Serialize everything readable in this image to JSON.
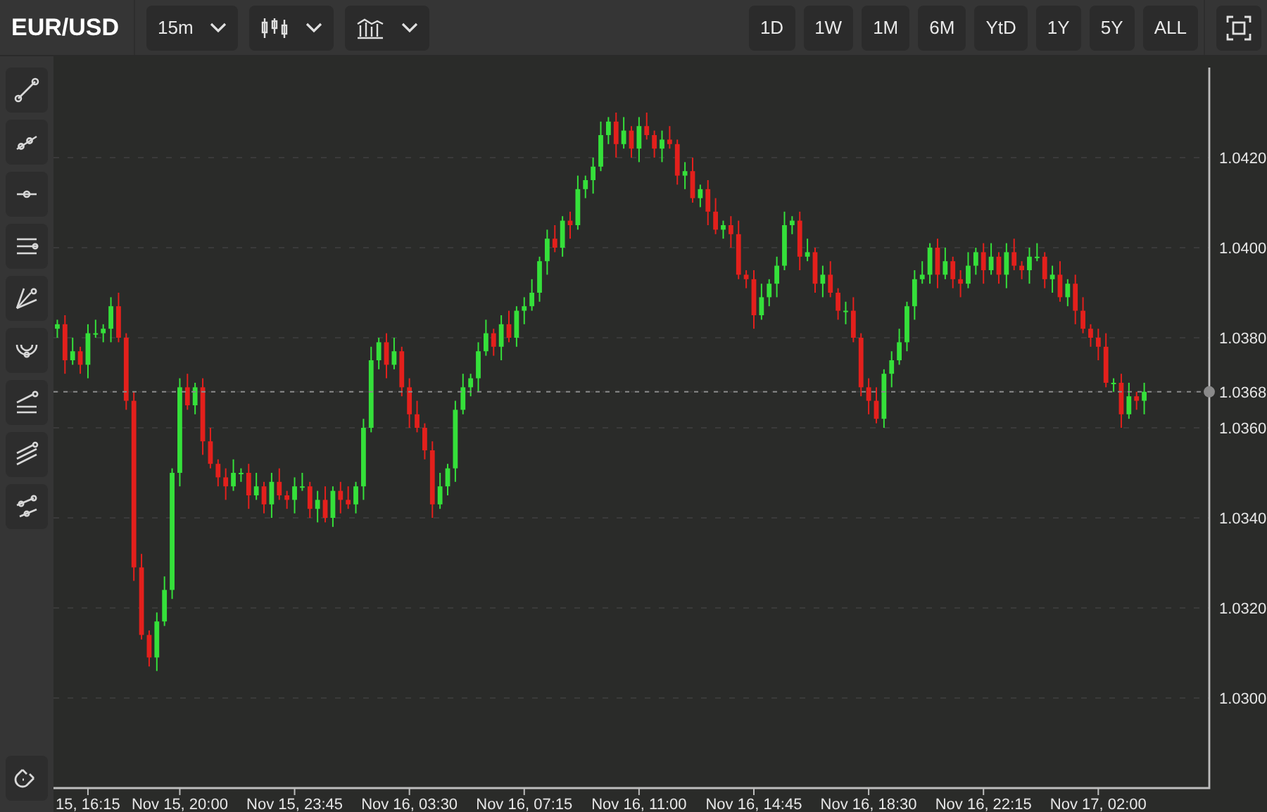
{
  "symbol": "EUR/USD",
  "interval": {
    "label": "15m"
  },
  "ranges": [
    {
      "label": "1D",
      "selected": false
    },
    {
      "label": "1W",
      "selected": false
    },
    {
      "label": "1M",
      "selected": false
    },
    {
      "label": "6M",
      "selected": false
    },
    {
      "label": "YtD",
      "selected": false
    },
    {
      "label": "1Y",
      "selected": false
    },
    {
      "label": "5Y",
      "selected": false
    },
    {
      "label": "ALL",
      "selected": false
    }
  ],
  "chart": {
    "chart_data": {
      "type": "candlestick",
      "categories": [
        null,
        null,
        null,
        null,
        "15, 16:15",
        null,
        null,
        null,
        null,
        null,
        null,
        null,
        null,
        null,
        null,
        null,
        "Nov 15, 20:00",
        null,
        null,
        null,
        null,
        null,
        null,
        null,
        null,
        null,
        null,
        null,
        null,
        null,
        null,
        "Nov 15, 23:45",
        null,
        null,
        null,
        null,
        null,
        null,
        null,
        null,
        null,
        null,
        null,
        null,
        null,
        null,
        "Nov 16, 03:30",
        null,
        null,
        null,
        null,
        null,
        null,
        null,
        null,
        null,
        null,
        null,
        null,
        null,
        null,
        "Nov 16, 07:15",
        null,
        null,
        null,
        null,
        null,
        null,
        null,
        null,
        null,
        null,
        null,
        null,
        null,
        null,
        "Nov 16, 11:00",
        null,
        null,
        null,
        null,
        null,
        null,
        null,
        null,
        null,
        null,
        null,
        null,
        null,
        null,
        "Nov 16, 14:45",
        null,
        null,
        null,
        null,
        null,
        null,
        null,
        null,
        null,
        null,
        null,
        null,
        null,
        null,
        "Nov 16, 18:30",
        null,
        null,
        null,
        null,
        null,
        null,
        null,
        null,
        null,
        null,
        null,
        null,
        null,
        null,
        "Nov 16, 22:15",
        null,
        null,
        null,
        null,
        null,
        null,
        null,
        null,
        null,
        null,
        null,
        null,
        null,
        null,
        "Nov 17, 02:00",
        null,
        null,
        null,
        null,
        null,
        null
      ],
      "ohlc": [
        [
          1.0382,
          1.0384,
          1.038,
          1.0383
        ],
        [
          1.0383,
          1.0385,
          1.0372,
          1.0375
        ],
        [
          1.0375,
          1.038,
          1.0374,
          1.0377
        ],
        [
          1.0377,
          1.0378,
          1.0372,
          1.0374
        ],
        [
          1.0374,
          1.0383,
          1.0371,
          1.0381
        ],
        [
          1.0381,
          1.0384,
          1.038,
          1.0381
        ],
        [
          1.0381,
          1.0383,
          1.0379,
          1.0382
        ],
        [
          1.0382,
          1.0389,
          1.0379,
          1.0387
        ],
        [
          1.0387,
          1.039,
          1.0379,
          1.038
        ],
        [
          1.038,
          1.0381,
          1.0364,
          1.0366
        ],
        [
          1.0366,
          1.0368,
          1.0326,
          1.0329
        ],
        [
          1.0329,
          1.0332,
          1.0313,
          1.0314
        ],
        [
          1.0314,
          1.0315,
          1.0307,
          1.0309
        ],
        [
          1.0309,
          1.0319,
          1.0306,
          1.0317
        ],
        [
          1.0317,
          1.0327,
          1.0316,
          1.0324
        ],
        [
          1.0324,
          1.0351,
          1.0322,
          1.035
        ],
        [
          1.035,
          1.0371,
          1.0347,
          1.0369
        ],
        [
          1.0369,
          1.0372,
          1.0364,
          1.0365
        ],
        [
          1.0365,
          1.037,
          1.0363,
          1.0369
        ],
        [
          1.0369,
          1.0371,
          1.0354,
          1.0357
        ],
        [
          1.0357,
          1.036,
          1.0351,
          1.0352
        ],
        [
          1.0352,
          1.0353,
          1.0347,
          1.0349
        ],
        [
          1.0349,
          1.0351,
          1.0344,
          1.0347
        ],
        [
          1.0347,
          1.0353,
          1.0346,
          1.035
        ],
        [
          1.035,
          1.0351,
          1.0348,
          1.035
        ],
        [
          1.035,
          1.0352,
          1.0342,
          1.0345
        ],
        [
          1.0345,
          1.035,
          1.0344,
          1.0347
        ],
        [
          1.0347,
          1.0348,
          1.0341,
          1.0343
        ],
        [
          1.0343,
          1.035,
          1.034,
          1.0348
        ],
        [
          1.0348,
          1.0351,
          1.0344,
          1.0345
        ],
        [
          1.0345,
          1.0346,
          1.0342,
          1.0344
        ],
        [
          1.0344,
          1.0349,
          1.0341,
          1.0347
        ],
        [
          1.0347,
          1.035,
          1.0346,
          1.0347
        ],
        [
          1.0347,
          1.0348,
          1.034,
          1.0342
        ],
        [
          1.0342,
          1.0346,
          1.0339,
          1.0344
        ],
        [
          1.0344,
          1.0347,
          1.0339,
          1.034
        ],
        [
          1.034,
          1.0347,
          1.0338,
          1.0346
        ],
        [
          1.0346,
          1.0348,
          1.0341,
          1.0344
        ],
        [
          1.0344,
          1.0347,
          1.0342,
          1.0343
        ],
        [
          1.0343,
          1.0348,
          1.0341,
          1.0347
        ],
        [
          1.0347,
          1.0362,
          1.0344,
          1.036
        ],
        [
          1.036,
          1.0378,
          1.0359,
          1.0375
        ],
        [
          1.0375,
          1.038,
          1.0373,
          1.0379
        ],
        [
          1.0379,
          1.0381,
          1.0371,
          1.0374
        ],
        [
          1.0374,
          1.038,
          1.0373,
          1.0377
        ],
        [
          1.0377,
          1.0378,
          1.0367,
          1.0369
        ],
        [
          1.0369,
          1.0371,
          1.036,
          1.0363
        ],
        [
          1.0363,
          1.0366,
          1.0359,
          1.036
        ],
        [
          1.036,
          1.0361,
          1.0353,
          1.0355
        ],
        [
          1.0355,
          1.0357,
          1.034,
          1.0343
        ],
        [
          1.0343,
          1.035,
          1.0342,
          1.0347
        ],
        [
          1.0347,
          1.0352,
          1.0345,
          1.0351
        ],
        [
          1.0351,
          1.0366,
          1.0348,
          1.0364
        ],
        [
          1.0364,
          1.0372,
          1.0363,
          1.0369
        ],
        [
          1.0369,
          1.0372,
          1.0367,
          1.0371
        ],
        [
          1.0371,
          1.0379,
          1.0368,
          1.0377
        ],
        [
          1.0377,
          1.0384,
          1.0376,
          1.0381
        ],
        [
          1.0381,
          1.0382,
          1.0376,
          1.0378
        ],
        [
          1.0378,
          1.0385,
          1.0375,
          1.0383
        ],
        [
          1.0383,
          1.0386,
          1.0379,
          1.038
        ],
        [
          1.038,
          1.0387,
          1.0378,
          1.0386
        ],
        [
          1.0386,
          1.0389,
          1.0383,
          1.0387
        ],
        [
          1.0387,
          1.0393,
          1.0386,
          1.039
        ],
        [
          1.039,
          1.0398,
          1.0388,
          1.0397
        ],
        [
          1.0397,
          1.0404,
          1.0394,
          1.0402
        ],
        [
          1.0402,
          1.0405,
          1.0399,
          1.04
        ],
        [
          1.04,
          1.0407,
          1.0398,
          1.0406
        ],
        [
          1.0406,
          1.0408,
          1.0402,
          1.0405
        ],
        [
          1.0405,
          1.0416,
          1.0404,
          1.0413
        ],
        [
          1.0413,
          1.0416,
          1.0411,
          1.0415
        ],
        [
          1.0415,
          1.042,
          1.0412,
          1.0418
        ],
        [
          1.0418,
          1.0428,
          1.0417,
          1.0425
        ],
        [
          1.0425,
          1.0429,
          1.0423,
          1.0428
        ],
        [
          1.0428,
          1.043,
          1.042,
          1.0423
        ],
        [
          1.0423,
          1.0429,
          1.0422,
          1.0426
        ],
        [
          1.0426,
          1.0427,
          1.042,
          1.0422
        ],
        [
          1.0422,
          1.0429,
          1.0419,
          1.0427
        ],
        [
          1.0427,
          1.043,
          1.0424,
          1.0425
        ],
        [
          1.0425,
          1.0426,
          1.042,
          1.0422
        ],
        [
          1.0422,
          1.0426,
          1.0419,
          1.0424
        ],
        [
          1.0424,
          1.0427,
          1.0422,
          1.0423
        ],
        [
          1.0423,
          1.0424,
          1.0414,
          1.0416
        ],
        [
          1.0416,
          1.0419,
          1.0413,
          1.0417
        ],
        [
          1.0417,
          1.042,
          1.041,
          1.0411
        ],
        [
          1.0411,
          1.0414,
          1.0409,
          1.0413
        ],
        [
          1.0413,
          1.0415,
          1.0405,
          1.0408
        ],
        [
          1.0408,
          1.0411,
          1.0403,
          1.0404
        ],
        [
          1.0404,
          1.0406,
          1.0402,
          1.0405
        ],
        [
          1.0405,
          1.0407,
          1.04,
          1.0403
        ],
        [
          1.0403,
          1.0406,
          1.0393,
          1.0394
        ],
        [
          1.0394,
          1.0395,
          1.0391,
          1.0393
        ],
        [
          1.0393,
          1.0395,
          1.0382,
          1.0385
        ],
        [
          1.0385,
          1.0392,
          1.0384,
          1.0389
        ],
        [
          1.0389,
          1.0393,
          1.0387,
          1.0392
        ],
        [
          1.0392,
          1.0398,
          1.0389,
          1.0396
        ],
        [
          1.0396,
          1.0408,
          1.0395,
          1.0405
        ],
        [
          1.0405,
          1.0407,
          1.0403,
          1.0406
        ],
        [
          1.0406,
          1.0408,
          1.0395,
          1.0398
        ],
        [
          1.0398,
          1.0402,
          1.0397,
          1.0399
        ],
        [
          1.0399,
          1.04,
          1.039,
          1.0392
        ],
        [
          1.0392,
          1.0396,
          1.0389,
          1.0394
        ],
        [
          1.0394,
          1.0397,
          1.0389,
          1.039
        ],
        [
          1.039,
          1.0391,
          1.0384,
          1.0386
        ],
        [
          1.0386,
          1.0388,
          1.0383,
          1.0386
        ],
        [
          1.0386,
          1.0389,
          1.0379,
          1.038
        ],
        [
          1.038,
          1.0381,
          1.0367,
          1.0369
        ],
        [
          1.0369,
          1.0371,
          1.0363,
          1.0366
        ],
        [
          1.0366,
          1.0369,
          1.0361,
          1.0362
        ],
        [
          1.0362,
          1.0373,
          1.036,
          1.0372
        ],
        [
          1.0372,
          1.0377,
          1.0369,
          1.0375
        ],
        [
          1.0375,
          1.0382,
          1.0374,
          1.0379
        ],
        [
          1.0379,
          1.0388,
          1.0377,
          1.0387
        ],
        [
          1.0387,
          1.0395,
          1.0384,
          1.0393
        ],
        [
          1.0393,
          1.0397,
          1.0392,
          1.0394
        ],
        [
          1.0394,
          1.0401,
          1.0392,
          1.04
        ],
        [
          1.04,
          1.0402,
          1.0391,
          1.0394
        ],
        [
          1.0394,
          1.04,
          1.0393,
          1.0397
        ],
        [
          1.0397,
          1.0398,
          1.0391,
          1.0393
        ],
        [
          1.0393,
          1.0395,
          1.0389,
          1.0392
        ],
        [
          1.0392,
          1.0399,
          1.0391,
          1.0396
        ],
        [
          1.0396,
          1.04,
          1.0394,
          1.0399
        ],
        [
          1.0399,
          1.0401,
          1.0392,
          1.0395
        ],
        [
          1.0395,
          1.0401,
          1.0394,
          1.0398
        ],
        [
          1.0398,
          1.0399,
          1.0392,
          1.0394
        ],
        [
          1.0394,
          1.0401,
          1.0391,
          1.0399
        ],
        [
          1.0399,
          1.0402,
          1.0395,
          1.0396
        ],
        [
          1.0396,
          1.0397,
          1.0393,
          1.0395
        ],
        [
          1.0395,
          1.04,
          1.0392,
          1.0398
        ],
        [
          1.0398,
          1.0401,
          1.0397,
          1.0398
        ],
        [
          1.0398,
          1.0399,
          1.0391,
          1.0393
        ],
        [
          1.0393,
          1.0396,
          1.039,
          1.0394
        ],
        [
          1.0394,
          1.0397,
          1.0388,
          1.0389
        ],
        [
          1.0389,
          1.0393,
          1.0387,
          1.0392
        ],
        [
          1.0392,
          1.0394,
          1.0383,
          1.0386
        ],
        [
          1.0386,
          1.0389,
          1.0381,
          1.0382
        ],
        [
          1.0382,
          1.0383,
          1.0378,
          1.038
        ],
        [
          1.038,
          1.0382,
          1.0375,
          1.0378
        ],
        [
          1.0378,
          1.0381,
          1.0369,
          1.037
        ],
        [
          1.037,
          1.0371,
          1.0368,
          1.037
        ],
        [
          1.037,
          1.0372,
          1.036,
          1.0363
        ],
        [
          1.0363,
          1.037,
          1.0362,
          1.0367
        ],
        [
          1.0367,
          1.0368,
          1.0364,
          1.0366
        ],
        [
          1.0366,
          1.037,
          1.0363,
          1.0368
        ]
      ],
      "grid": true,
      "ylim": [
        1.028,
        1.044
      ],
      "yticks": [
        {
          "value": 1.042,
          "label": "1.0420"
        },
        {
          "value": 1.04,
          "label": "1.0400"
        },
        {
          "value": 1.038,
          "label": "1.0380"
        },
        {
          "value": 1.0368,
          "label": "1.0368"
        },
        {
          "value": 1.036,
          "label": "1.0360"
        },
        {
          "value": 1.034,
          "label": "1.0340"
        },
        {
          "value": 1.032,
          "label": "1.0320"
        },
        {
          "value": 1.03,
          "label": "1.0300"
        }
      ],
      "ref_lines": [
        {
          "axis": "y",
          "value": 1.0368
        }
      ]
    }
  }
}
